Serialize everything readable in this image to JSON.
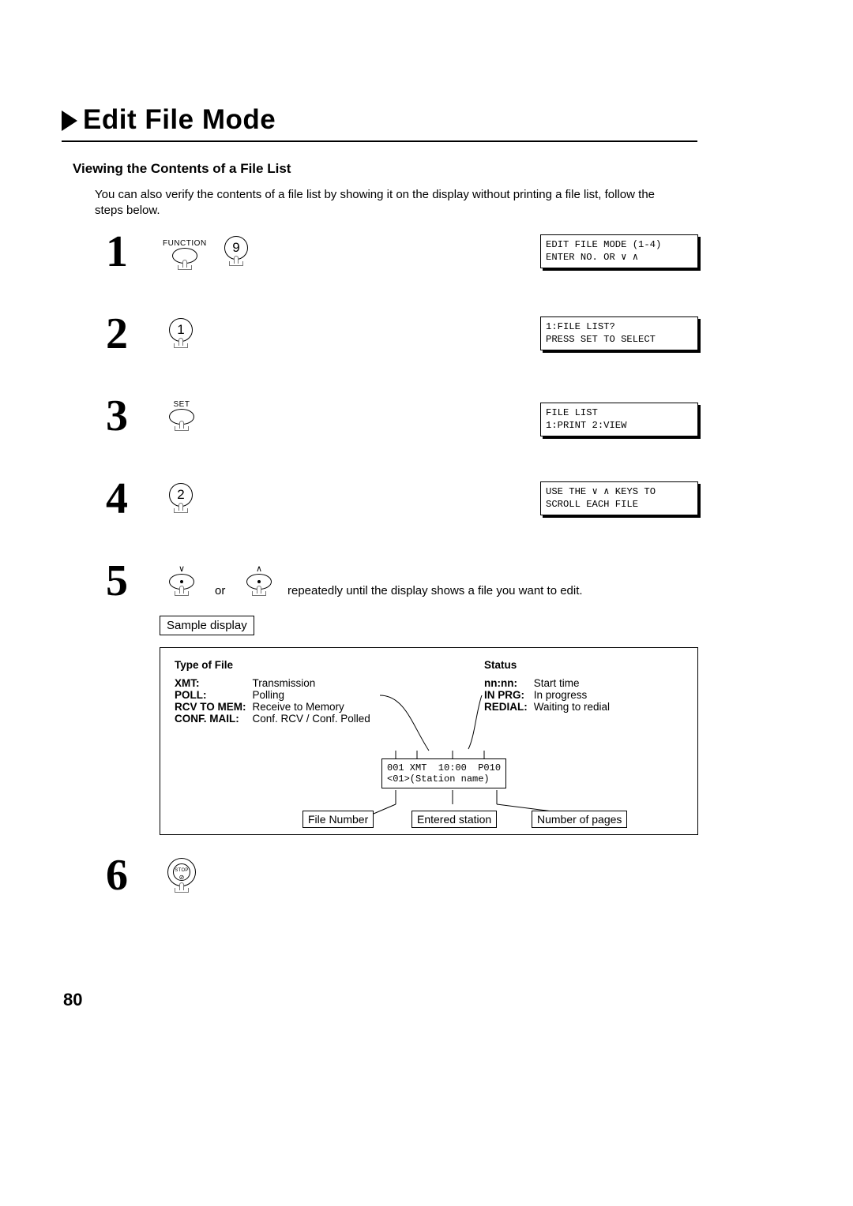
{
  "title": "Edit File Mode",
  "subheading": "Viewing the Contents of a File List",
  "intro": "You can also verify the contents of a file list by showing it on the display without printing a file list, follow the steps below.",
  "steps": {
    "1": {
      "label_function": "FUNCTION",
      "key": "9",
      "lcd": "EDIT FILE MODE (1-4)\nENTER NO. OR ∨ ∧"
    },
    "2": {
      "key": "1",
      "lcd": "1:FILE LIST?\nPRESS SET TO SELECT"
    },
    "3": {
      "label_set": "SET",
      "lcd": "FILE LIST\n1:PRINT 2:VIEW"
    },
    "4": {
      "key": "2",
      "lcd": "USE THE ∨ ∧ KEYS TO\nSCROLL EACH FILE"
    },
    "5": {
      "or": "or",
      "tail": "repeatedly until the display shows a file you want to edit.",
      "sample_display": "Sample display",
      "type_heading": "Type of File",
      "type_rows": {
        "xmt_k": "XMT:",
        "xmt_v": "Transmission",
        "poll_k": "POLL:",
        "poll_v": "Polling",
        "rcv_k": "RCV TO MEM:",
        "rcv_v": "Receive to Memory",
        "conf_k": "CONF. MAIL:",
        "conf_v": "Conf. RCV / Conf. Polled"
      },
      "status_heading": "Status",
      "status_rows": {
        "nn_k": "nn:nn:",
        "nn_v": "Start time",
        "prg_k": "IN PRG:",
        "prg_v": "In progress",
        "red_k": "REDIAL:",
        "red_v": "Waiting to redial"
      },
      "lcd_center": "001 XMT  10:00  P010\n<01>(Station name)",
      "anno_file": "File Number",
      "anno_station": "Entered station",
      "anno_pages": "Number of pages"
    },
    "6": {
      "stop_label": "STOP"
    }
  },
  "page_num": "80"
}
